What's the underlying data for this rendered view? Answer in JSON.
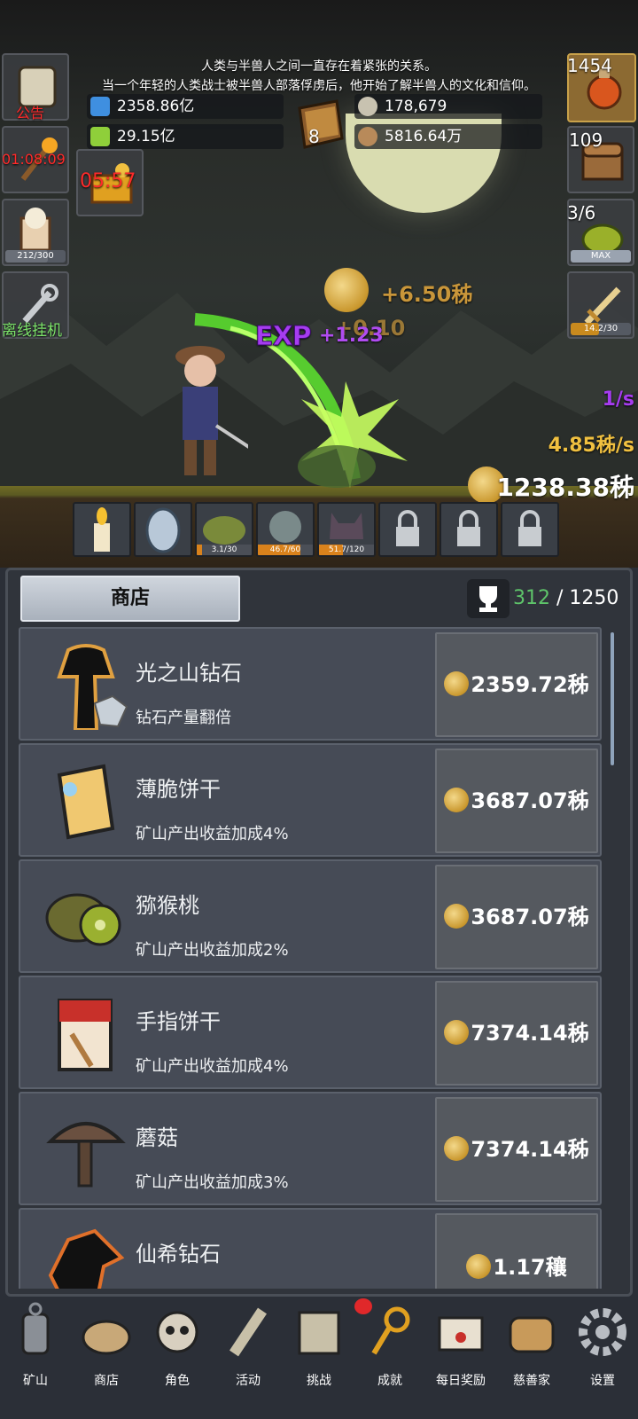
{
  "story": {
    "line1": "人类与半兽人之间一直存在着紧张的关系。",
    "line2": "当一个年轻的人类战士被半兽人部落俘虏后，他开始了解半兽人的文化和信仰。"
  },
  "resources": {
    "blue_potion": "2358.86亿",
    "green_potion": "29.15亿",
    "book_count": "8",
    "silver_coin": "178,679",
    "bronze_coin": "5816.64万"
  },
  "left_side": {
    "notice_label": "公告",
    "torch_timer": "01:08:09",
    "chest_timer": "05:57",
    "beer_progress": "212/300",
    "beer_fill": 0.707,
    "offline_label": "离线挂机"
  },
  "right_side": {
    "potion_count": "1454",
    "chest_count": "109",
    "slime_count": "3/6",
    "slime_badge": "MAX",
    "sword_progress": "14.2/30",
    "sword_fill": 0.473
  },
  "battle": {
    "coin_gain": "+6.50秭",
    "hidden_gain": "+0.10",
    "exp_label": "EXP",
    "exp_gain": "+1.23",
    "rate_per_s": "1/s",
    "coin_rate": "4.85秭/s",
    "total_coins": "1238.38秭"
  },
  "slots": [
    {
      "name": "candle",
      "label": ""
    },
    {
      "name": "egg",
      "label": ""
    },
    {
      "name": "slime",
      "label": "3.1/30",
      "fill": 0.103
    },
    {
      "name": "zombie",
      "label": "46.7/60",
      "fill": 0.778
    },
    {
      "name": "cat-demon",
      "label": "51.7/120",
      "fill": 0.431
    },
    {
      "name": "locked-1",
      "label": ""
    },
    {
      "name": "locked-2",
      "label": ""
    },
    {
      "name": "locked-3",
      "label": ""
    }
  ],
  "shop": {
    "tab_label": "商店",
    "progress_current": "312",
    "progress_sep": " / ",
    "progress_total": "1250",
    "items": [
      {
        "name": "光之山钻石",
        "desc": "钻石产量翻倍",
        "price": "2359.72秭"
      },
      {
        "name": "薄脆饼干",
        "desc": "矿山产出收益加成4%",
        "price": "3687.07秭"
      },
      {
        "name": "猕猴桃",
        "desc": "矿山产出收益加成2%",
        "price": "3687.07秭"
      },
      {
        "name": "手指饼干",
        "desc": "矿山产出收益加成4%",
        "price": "7374.14秭"
      },
      {
        "name": "蘑菇",
        "desc": "矿山产出收益加成3%",
        "price": "7374.14秭"
      },
      {
        "name": "仙希钻石",
        "desc": "",
        "price": "1.17穰"
      }
    ]
  },
  "nav": [
    {
      "label": "矿山",
      "icon": "lantern-icon"
    },
    {
      "label": "商店",
      "icon": "shop-icon"
    },
    {
      "label": "角色",
      "icon": "skull-icon"
    },
    {
      "label": "活动",
      "icon": "scroll-icon"
    },
    {
      "label": "挑战",
      "icon": "map-icon"
    },
    {
      "label": "成就",
      "icon": "key-icon"
    },
    {
      "label": "每日奖励",
      "icon": "letter-icon"
    },
    {
      "label": "慈善家",
      "icon": "bread-icon"
    },
    {
      "label": "设置",
      "icon": "gear-icon"
    }
  ],
  "colors": {
    "timer_red": "#ff2a2a",
    "gold_text": "#f0c040",
    "exp_purple": "#b04cf0",
    "progress_green": "#5ec46a"
  }
}
